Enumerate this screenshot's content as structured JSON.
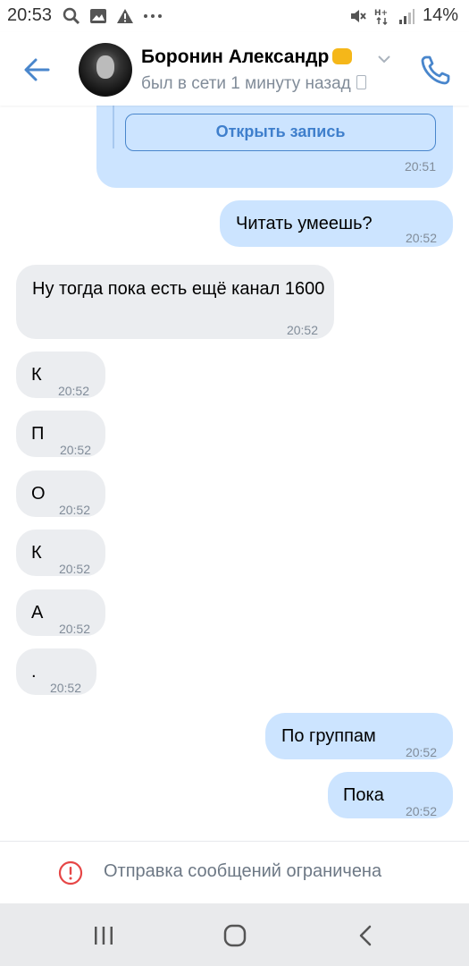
{
  "status_bar": {
    "time": "20:53",
    "battery": "14%",
    "left_icons": [
      "search-icon",
      "image-icon",
      "warning-icon",
      "more-icon"
    ],
    "right_icons": [
      "mute-icon",
      "signal-h-plus-icon",
      "signal-bars-icon"
    ]
  },
  "header": {
    "name": "Боронин Александр",
    "status": "был в сети 1 минуту назад"
  },
  "messages": {
    "m0": {
      "button": "Открыть запись",
      "time": "20:51"
    },
    "m1": {
      "text": "Читать умеешь?",
      "time": "20:52"
    },
    "m2": {
      "text": "Ну тогда пока есть ещё канал 1600",
      "time": "20:52"
    },
    "m3": {
      "text": "К",
      "time": "20:52"
    },
    "m4": {
      "text": "П",
      "time": "20:52"
    },
    "m5": {
      "text": "О",
      "time": "20:52"
    },
    "m6": {
      "text": "К",
      "time": "20:52"
    },
    "m7": {
      "text": "А",
      "time": "20:52"
    },
    "m8": {
      "text": ".",
      "time": "20:52"
    },
    "m9": {
      "text": "По группам",
      "time": "20:52"
    },
    "m10": {
      "text": "Пока",
      "time": "20:52"
    }
  },
  "notice": {
    "text": "Отправка сообщений ограничена"
  },
  "colors": {
    "accent": "#4986cc",
    "outgoing_bubble": "#cce4ff",
    "incoming_bubble": "#ebedf0",
    "error": "#e64646"
  }
}
